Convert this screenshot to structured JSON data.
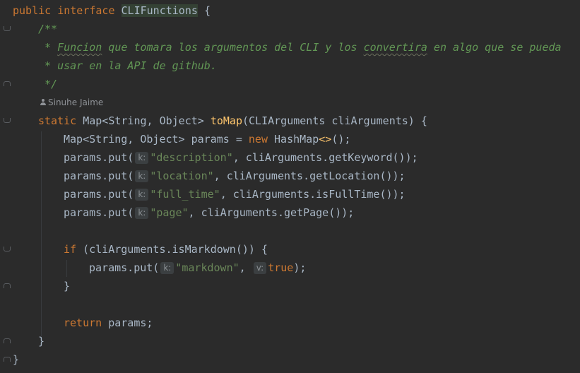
{
  "editor": {
    "author": "Sinuhe Jaime",
    "lines": {
      "l1": {
        "kw1": "public",
        "kw2": "interface",
        "name": "CLIFunctions",
        "brace": "{"
      },
      "l2": {
        "doc": "/**"
      },
      "l3": {
        "star": " * ",
        "w1": "Funcion",
        "t1": " que tomara los argumentos del CLI y los ",
        "w2": "convertira",
        "t2": " en algo que se pueda"
      },
      "l4": {
        "doc": " * usar en la API de github."
      },
      "l5": {
        "doc": " */"
      },
      "l6": {
        "kw": "static",
        "t1": " Map<String, Object> ",
        "fn": "toMap",
        "t2": "(CLIArguments cliArguments) ",
        "brace": "{"
      },
      "l7": {
        "t1": "Map<String, Object> params = ",
        "kw": "new",
        "t2": " HashMap",
        "diamond": "<>",
        "t3": "();"
      },
      "l8": {
        "t1": "params.put(",
        "hint": "k:",
        "str": "\"description\"",
        "t2": ", cliArguments.getKeyword());"
      },
      "l9": {
        "t1": "params.put(",
        "hint": "k:",
        "str": "\"location\"",
        "t2": ", cliArguments.getLocation());"
      },
      "l10": {
        "t1": "params.put(",
        "hint": "k:",
        "str": "\"full_time\"",
        "t2": ", cliArguments.isFullTime());"
      },
      "l11": {
        "t1": "params.put(",
        "hint": "k:",
        "str": "\"page\"",
        "t2": ", cliArguments.getPage());"
      },
      "l12": {
        "kw": "if",
        "t1": " (cliArguments.isMarkdown()) ",
        "brace": "{"
      },
      "l13": {
        "t1": "params.put(",
        "hint1": "k:",
        "str": "\"markdown\"",
        "t2": ", ",
        "hint2": "v:",
        "kw": "true",
        "t3": ");"
      },
      "l14": {
        "brace": "}"
      },
      "l15": {
        "kw": "return",
        "t1": " params;"
      },
      "l16": {
        "brace": "}"
      },
      "l17": {
        "brace": "}"
      }
    }
  },
  "colors": {
    "background": "#2b2b2b",
    "keyword": "#cc7832",
    "text": "#a9b7c6",
    "function": "#ffc66d",
    "string": "#6a8759",
    "doc_comment": "#629755",
    "inlay_hint_bg": "#3b3f41"
  },
  "icons": {
    "author": "person-icon",
    "fold": "fold-marker-icon"
  }
}
